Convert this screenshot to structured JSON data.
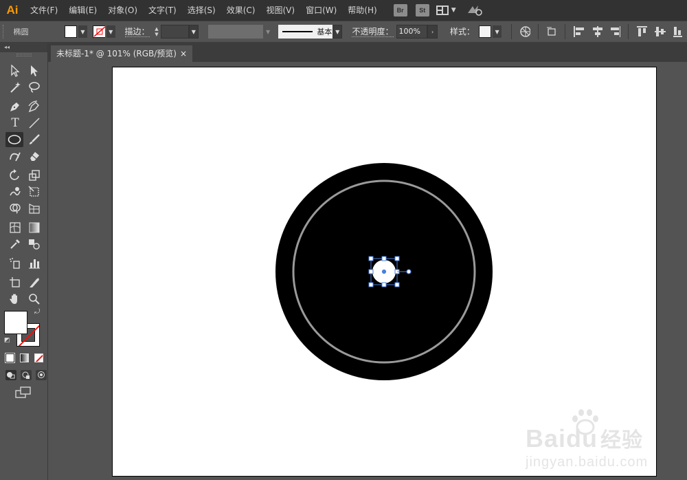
{
  "app": {
    "logo": "Ai"
  },
  "menu": [
    {
      "label": "文件(F)"
    },
    {
      "label": "编辑(E)"
    },
    {
      "label": "对象(O)"
    },
    {
      "label": "文字(T)"
    },
    {
      "label": "选择(S)"
    },
    {
      "label": "效果(C)"
    },
    {
      "label": "视图(V)"
    },
    {
      "label": "窗口(W)"
    },
    {
      "label": "帮助(H)"
    }
  ],
  "bridge": {
    "br": "Br",
    "st": "St"
  },
  "control": {
    "shape_label": "椭圆",
    "stroke_label": "描边：",
    "brush_label": "基本",
    "opacity_label": "不透明度：",
    "opacity_value": "100%",
    "style_label": "样式："
  },
  "document": {
    "tab_title": "未标题-1* @ 101% (RGB/预览)",
    "close_glyph": "×"
  },
  "artwork": {
    "outer_fill": "#000000",
    "ring_color": "#9a9a9a",
    "selected_fill": "#ffffff",
    "selection_color": "#4a7fe0"
  },
  "watermark": {
    "brand_latin": "Bai",
    "brand_paw": "du",
    "brand_cjk": "经验",
    "url": "jingyan.baidu.com"
  },
  "colors": {
    "accent": "#ff9a00",
    "menubar": "#323232",
    "panel": "#535353"
  }
}
